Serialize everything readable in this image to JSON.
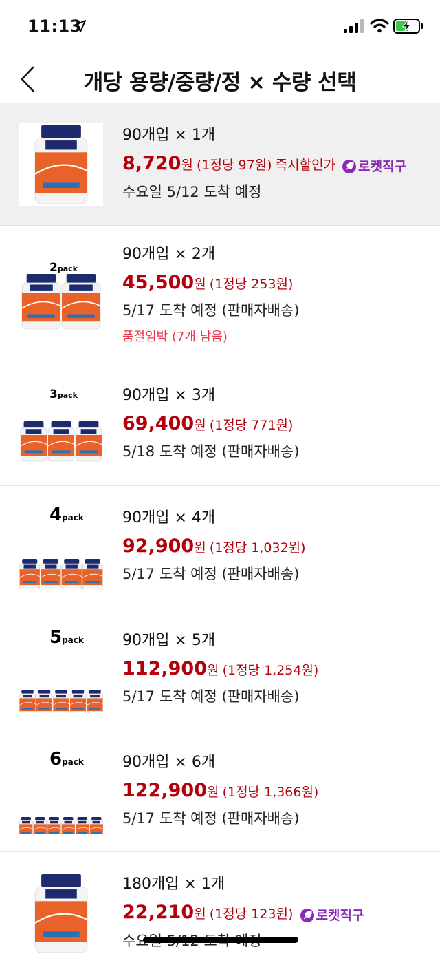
{
  "status_bar": {
    "time": "11:13"
  },
  "header": {
    "title": "개당 용량/중량/정 × 수량 선택"
  },
  "options": [
    {
      "quantity": "90개입 × 1개",
      "price": "8,720",
      "won": "원",
      "unit_price": "(1정당 97원)",
      "instant_label": "즉시할인가",
      "rocket": "로켓직구",
      "delivery": "수요일 5/12 도착 예정",
      "pack_label": "",
      "selected": true
    },
    {
      "quantity": "90개입 × 2개",
      "price": "45,500",
      "won": "원",
      "unit_price": "(1정당 253원)",
      "delivery": "5/17 도착 예정 (판매자배송)",
      "stock_note": "품절임박 (7개 남음)",
      "pack_label": "2pack"
    },
    {
      "quantity": "90개입 × 3개",
      "price": "69,400",
      "won": "원",
      "unit_price": "(1정당 771원)",
      "delivery": "5/18 도착 예정 (판매자배송)",
      "pack_label": "3pack"
    },
    {
      "quantity": "90개입 × 4개",
      "price": "92,900",
      "won": "원",
      "unit_price": "(1정당 1,032원)",
      "delivery": "5/17 도착 예정 (판매자배송)",
      "pack_label": "4pack"
    },
    {
      "quantity": "90개입 × 5개",
      "price": "112,900",
      "won": "원",
      "unit_price": "(1정당 1,254원)",
      "delivery": "5/17 도착 예정 (판매자배송)",
      "pack_label": "5pack"
    },
    {
      "quantity": "90개입 × 6개",
      "price": "122,900",
      "won": "원",
      "unit_price": "(1정당 1,366원)",
      "delivery": "5/17 도착 예정 (판매자배송)",
      "pack_label": "6pack"
    },
    {
      "quantity": "180개입 × 1개",
      "price": "22,210",
      "won": "원",
      "unit_price": "(1정당 123원)",
      "rocket": "로켓직구",
      "delivery": "수요일 5/12 도착 예정",
      "pack_label": ""
    }
  ],
  "colors": {
    "price": "#b3000c",
    "stock_warning": "#e6394b",
    "rocket": "#8a2bb8",
    "selected_bg": "#f0f0f0",
    "bottle_label": "#e8622a",
    "bottle_cap": "#1d2a6e"
  },
  "icons": {
    "back": "chevron-left-icon",
    "location": "location-arrow-icon",
    "signal": "cellular-signal-icon",
    "wifi": "wifi-icon",
    "battery": "battery-charging-icon",
    "rocket": "rocket-direct-icon"
  }
}
